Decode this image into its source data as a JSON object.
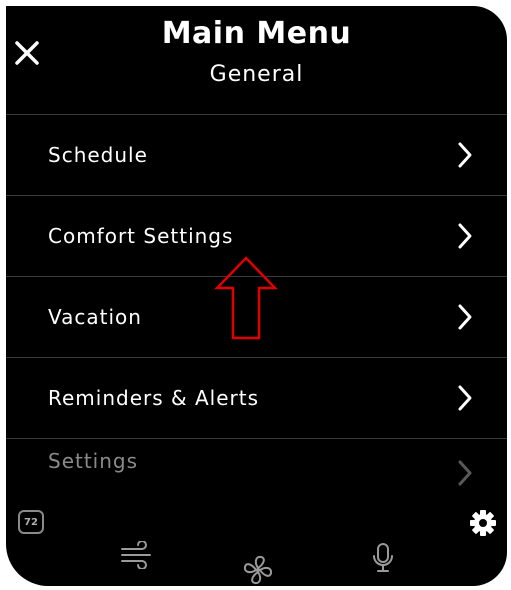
{
  "header": {
    "title": "Main Menu",
    "subtitle": "General"
  },
  "menu": {
    "items": [
      {
        "label": "Schedule"
      },
      {
        "label": "Comfort Settings"
      },
      {
        "label": "Vacation"
      },
      {
        "label": "Reminders & Alerts"
      },
      {
        "label": "Settings"
      }
    ]
  },
  "bottom_bar": {
    "temperature_badge": "72"
  },
  "icons": {
    "close": "close-icon",
    "chevron": "chevron-right-icon",
    "annotation": "up-arrow-annotation",
    "gear": "gear-icon",
    "wind": "wind-icon",
    "fan": "fan-icon",
    "mic": "microphone-icon"
  },
  "colors": {
    "background": "#000000",
    "text": "#ffffff",
    "divider": "#3a3a3a",
    "annotation_arrow": "#e00000"
  }
}
